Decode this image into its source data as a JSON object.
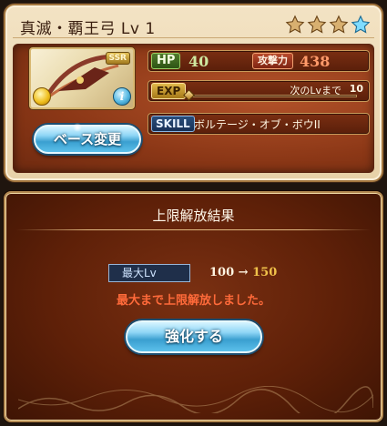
{
  "weapon": {
    "name": "真滅・覇王弓 Lv 1",
    "rarity_badge": "SSR",
    "stars_filled": 3,
    "stars_total": 4
  },
  "stats": {
    "hp_label": "HP",
    "hp_value": "40",
    "atk_label": "攻撃力",
    "atk_value": "438",
    "exp_label": "EXP",
    "exp_next_label": "次のLvまで",
    "exp_next_value": "10",
    "skill_label": "SKILL",
    "skill_name": "ボルテージ・オブ・ボウII"
  },
  "buttons": {
    "base_change": "ベース変更",
    "enhance": "強化する"
  },
  "result": {
    "title": "上限解放結果",
    "max_lv_label": "最大Lv",
    "lv_old": "100",
    "arrow": "→",
    "lv_new": "150",
    "message": "最大まで上限解放しました。"
  },
  "colors": {
    "card_bg": "#ecd7b0",
    "panel_bg": "#5e2008",
    "accent_blue": "#5cc0ea",
    "message_red": "#ff6a3a",
    "lv_gold": "#f0c24a"
  }
}
